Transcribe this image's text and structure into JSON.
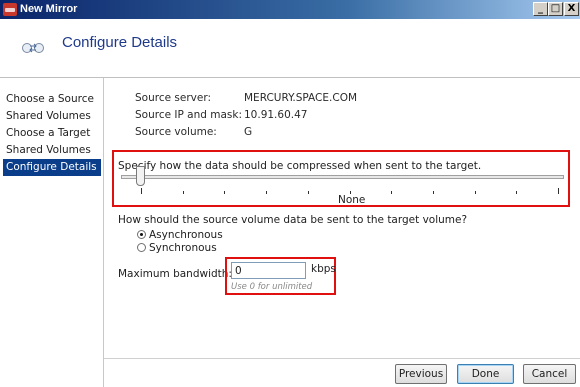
{
  "window": {
    "title": "New Mirror",
    "minimize": "_",
    "restore": "□",
    "close": "X"
  },
  "header": {
    "title": "Configure Details"
  },
  "nav": {
    "items": [
      {
        "label": "Choose a Source",
        "active": false
      },
      {
        "label": "Shared Volumes",
        "active": false
      },
      {
        "label": "Choose a Target",
        "active": false
      },
      {
        "label": "Shared Volumes",
        "active": false
      },
      {
        "label": "Configure Details",
        "active": true
      }
    ]
  },
  "source": {
    "server_label": "Source server:",
    "server_value": "MERCURY.SPACE.COM",
    "ip_label": "Source IP and mask:",
    "ip_value": "10.91.60.47",
    "volume_label": "Source volume:",
    "volume_value": "G"
  },
  "compression": {
    "prompt": "Specify how the data should be compressed when sent to the target.",
    "value_label": "None",
    "level": 0,
    "tick_count": 11
  },
  "transfer": {
    "question": "How should the source volume data be sent to the target volume?",
    "options": [
      {
        "label": "Asynchronous",
        "selected": true
      },
      {
        "label": "Synchronous",
        "selected": false
      }
    ]
  },
  "bandwidth": {
    "label": "Maximum bandwidth:",
    "value": "0",
    "unit": "kbps",
    "hint": "Use 0 for unlimited"
  },
  "buttons": {
    "previous": "Previous",
    "done": "Done",
    "cancel": "Cancel"
  },
  "colors": {
    "highlight": "#e01010",
    "nav_active": "#0a3d8a",
    "title_blue": "#1f3a8a"
  }
}
